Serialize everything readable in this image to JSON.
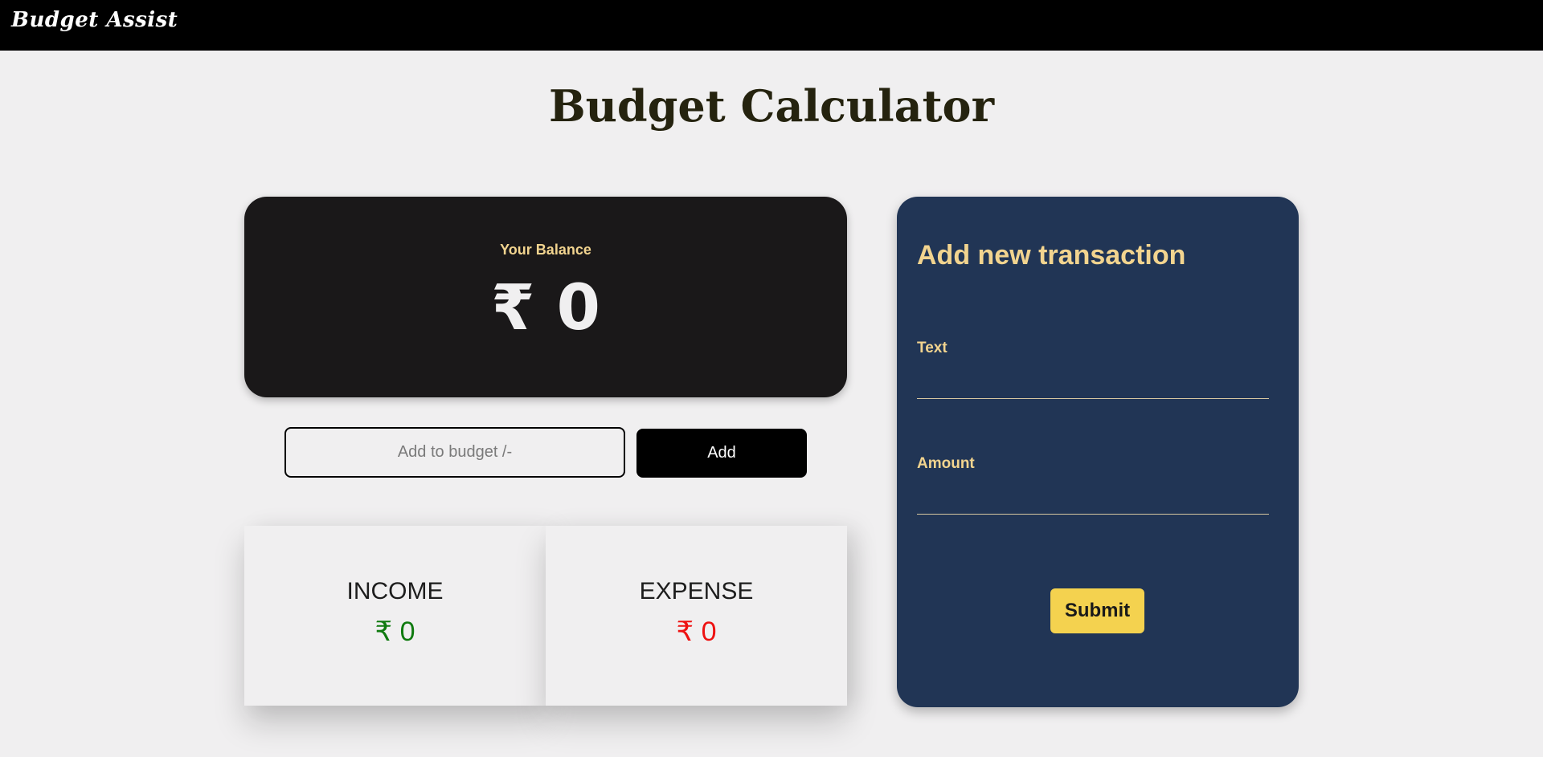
{
  "navbar": {
    "brand": "Budget Assist"
  },
  "page": {
    "title": "Budget Calculator"
  },
  "balance": {
    "label": "Your Balance",
    "value": "₹ 0"
  },
  "budget_form": {
    "placeholder": "Add to budget /-",
    "value": "",
    "button_label": "Add"
  },
  "summary": {
    "income": {
      "label": "INCOME",
      "value": "₹ 0"
    },
    "expense": {
      "label": "EXPENSE",
      "value": "₹ 0"
    }
  },
  "transaction_form": {
    "title": "Add new transaction",
    "text_label": "Text",
    "text_value": "",
    "amount_label": "Amount",
    "amount_value": "",
    "submit_label": "Submit"
  },
  "colors": {
    "navbar_bg": "#000000",
    "page_bg": "#f0eff0",
    "balance_card_bg": "#1a1819",
    "accent_gold": "#f2d48f",
    "transaction_card_bg": "#213555",
    "submit_button_bg": "#f4d24f",
    "income_green": "#0f7a0f",
    "expense_red": "#ee1111"
  }
}
